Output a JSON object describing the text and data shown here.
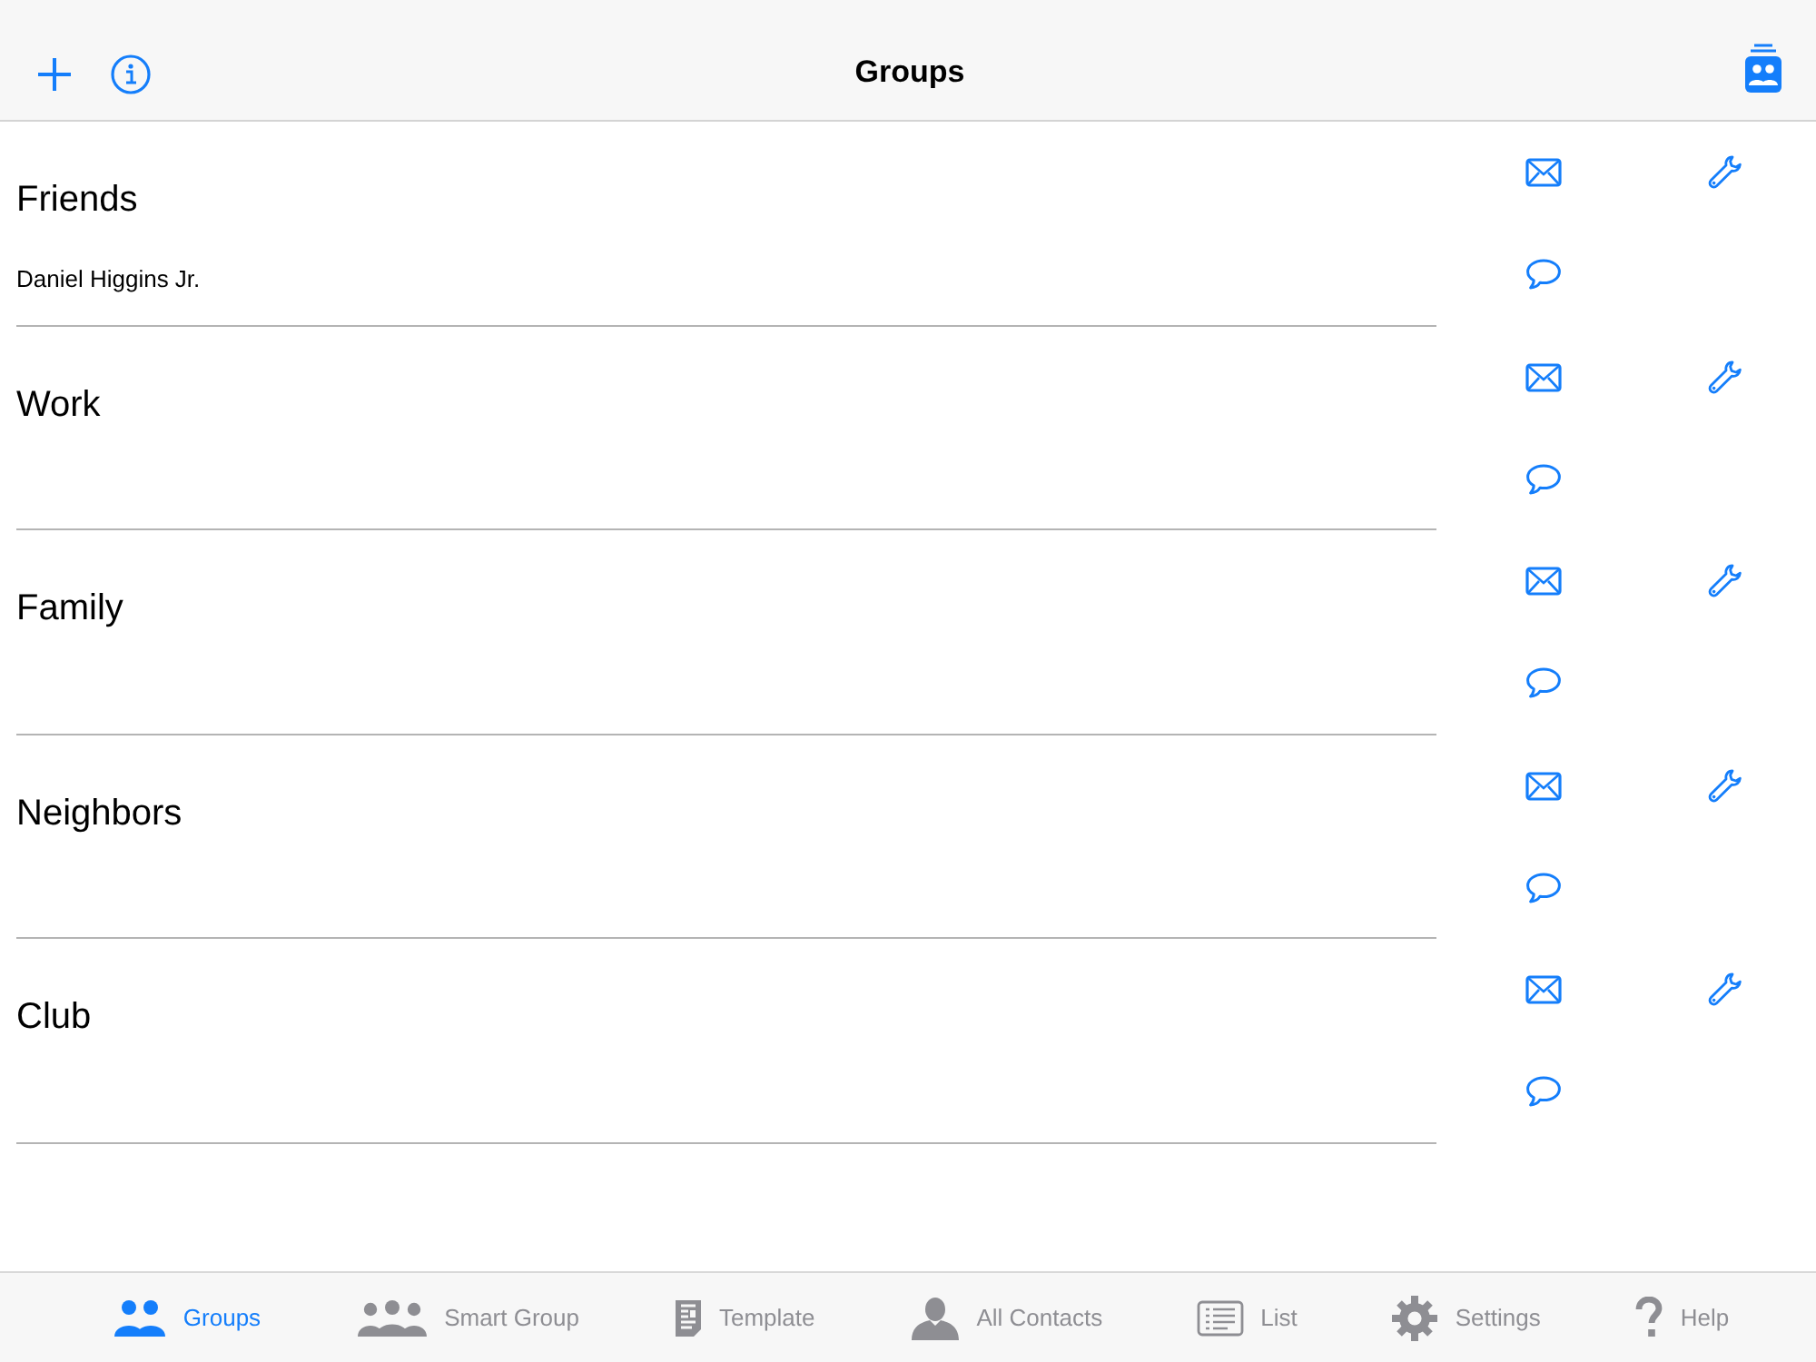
{
  "navigation_bar": {
    "title": "Groups"
  },
  "groups": [
    {
      "name": "Friends",
      "members": [
        "Daniel Higgins Jr."
      ]
    },
    {
      "name": "Work"
    },
    {
      "name": "Family"
    },
    {
      "name": "Neighbors"
    },
    {
      "name": "Club"
    }
  ],
  "tab_bar": [
    {
      "label": "Groups",
      "kind": "groups",
      "selected": true
    },
    {
      "label": "Smart Group",
      "kind": "smart",
      "selected": false
    },
    {
      "label": "Template",
      "kind": "template",
      "selected": false
    },
    {
      "label": "All Contacts",
      "kind": "contacts",
      "selected": false
    },
    {
      "label": "List",
      "kind": "list",
      "selected": false
    },
    {
      "label": "Settings",
      "kind": "settings",
      "selected": false
    },
    {
      "label": "Help",
      "kind": "help",
      "selected": false
    }
  ]
}
